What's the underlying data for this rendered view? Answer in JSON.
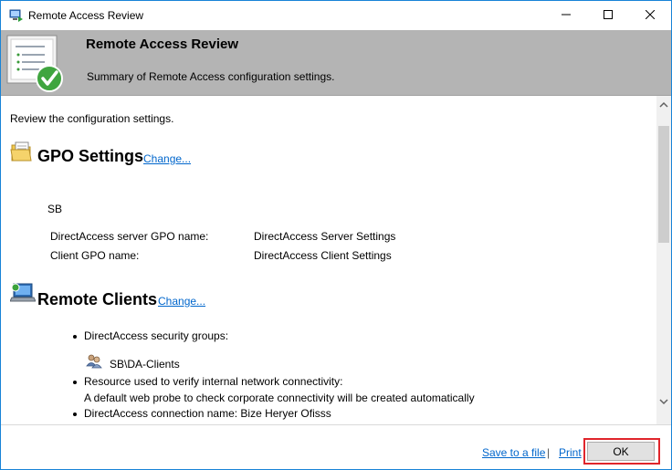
{
  "window": {
    "title": "Remote Access Review",
    "controls": {
      "minimize": "minimize-icon",
      "maximize": "maximize-icon",
      "close": "close-icon"
    }
  },
  "header": {
    "title": "Remote Access Review",
    "subtitle": "Summary of Remote Access configuration settings."
  },
  "content": {
    "intro": "Review the configuration settings.",
    "gpo_section": {
      "title": "GPO Settings",
      "change_link": "Change...",
      "domain": "SB",
      "rows": [
        {
          "label": "DirectAccess server GPO name:",
          "value": "DirectAccess Server Settings"
        },
        {
          "label": "Client GPO name:",
          "value": "DirectAccess Client Settings"
        }
      ]
    },
    "clients_section": {
      "title": "Remote Clients",
      "change_link": "Change...",
      "items": [
        {
          "text": "DirectAccess security groups:"
        },
        {
          "group": "SB\\DA-Clients"
        },
        {
          "text": "Resource used to verify internal network connectivity:"
        },
        {
          "text": "A default web probe to check corporate connectivity will be created automatically"
        },
        {
          "text": "DirectAccess connection name: Bize Heryer Ofisss"
        }
      ]
    }
  },
  "footer": {
    "save_link": "Save to a file",
    "separator": "|",
    "print_link": "Print",
    "ok_label": "OK"
  },
  "colors": {
    "header_bg": "#b4b4b4",
    "link": "#0066cc",
    "highlight": "#e0252b",
    "window_border": "#1883d7"
  }
}
